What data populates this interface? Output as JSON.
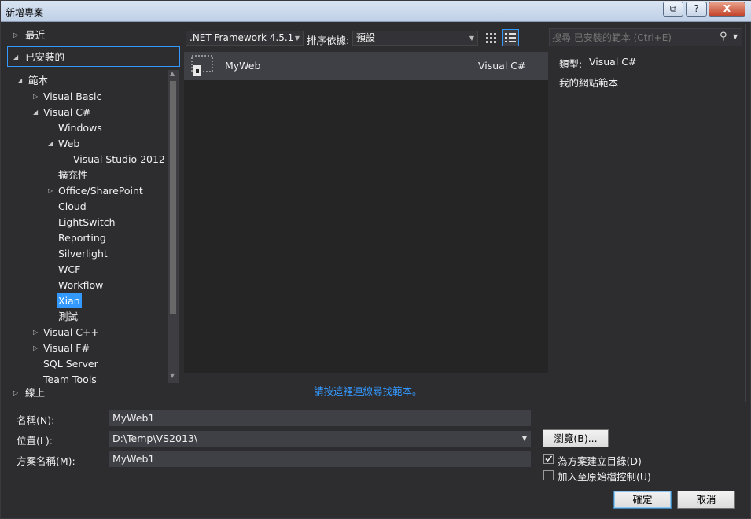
{
  "window": {
    "title": "新增專案",
    "controls": {
      "restore": "⧉",
      "help": "?",
      "close": "X"
    }
  },
  "left_tree": {
    "recent": "最近",
    "installed": "已安裝的",
    "templates": "範本",
    "items": [
      "Visual Basic",
      "Visual C#",
      "Windows",
      "Web",
      "Visual Studio 2012",
      "擴充性",
      "Office/SharePoint",
      "Cloud",
      "LightSwitch",
      "Reporting",
      "Silverlight",
      "WCF",
      "Workflow",
      "Xian",
      "測試",
      "Visual C++",
      "Visual F#",
      "SQL Server",
      "Team Tools"
    ],
    "online": "線上"
  },
  "toolbar": {
    "framework": ".NET Framework 4.5.1",
    "sort_label": "排序依據:",
    "sort_value": "預設",
    "search_placeholder": "搜尋 已安裝的範本 (Ctrl+E)"
  },
  "templates": [
    {
      "name": "MyWeb",
      "language": "Visual C#"
    }
  ],
  "details": {
    "type_label": "類型:",
    "type_value": "Visual C#",
    "description": "我的網站範本"
  },
  "online_link": "請按這裡連線尋找範本。",
  "form": {
    "name_label": "名稱(N):",
    "name_value": "MyWeb1",
    "location_label": "位置(L):",
    "location_value": "D:\\Temp\\VS2013\\",
    "solution_label": "方案名稱(M):",
    "solution_value": "MyWeb1",
    "browse": "瀏覽(B)...",
    "create_dir": "為方案建立目錄(D)",
    "create_dir_checked": true,
    "source_control": "加入至原始檔控制(U)",
    "source_control_checked": false,
    "ok": "確定",
    "cancel": "取消"
  },
  "colors": {
    "background": "#2d2d30",
    "selection": "#3399ff",
    "template_selected": "#3f3f46",
    "link": "#3399ff"
  }
}
